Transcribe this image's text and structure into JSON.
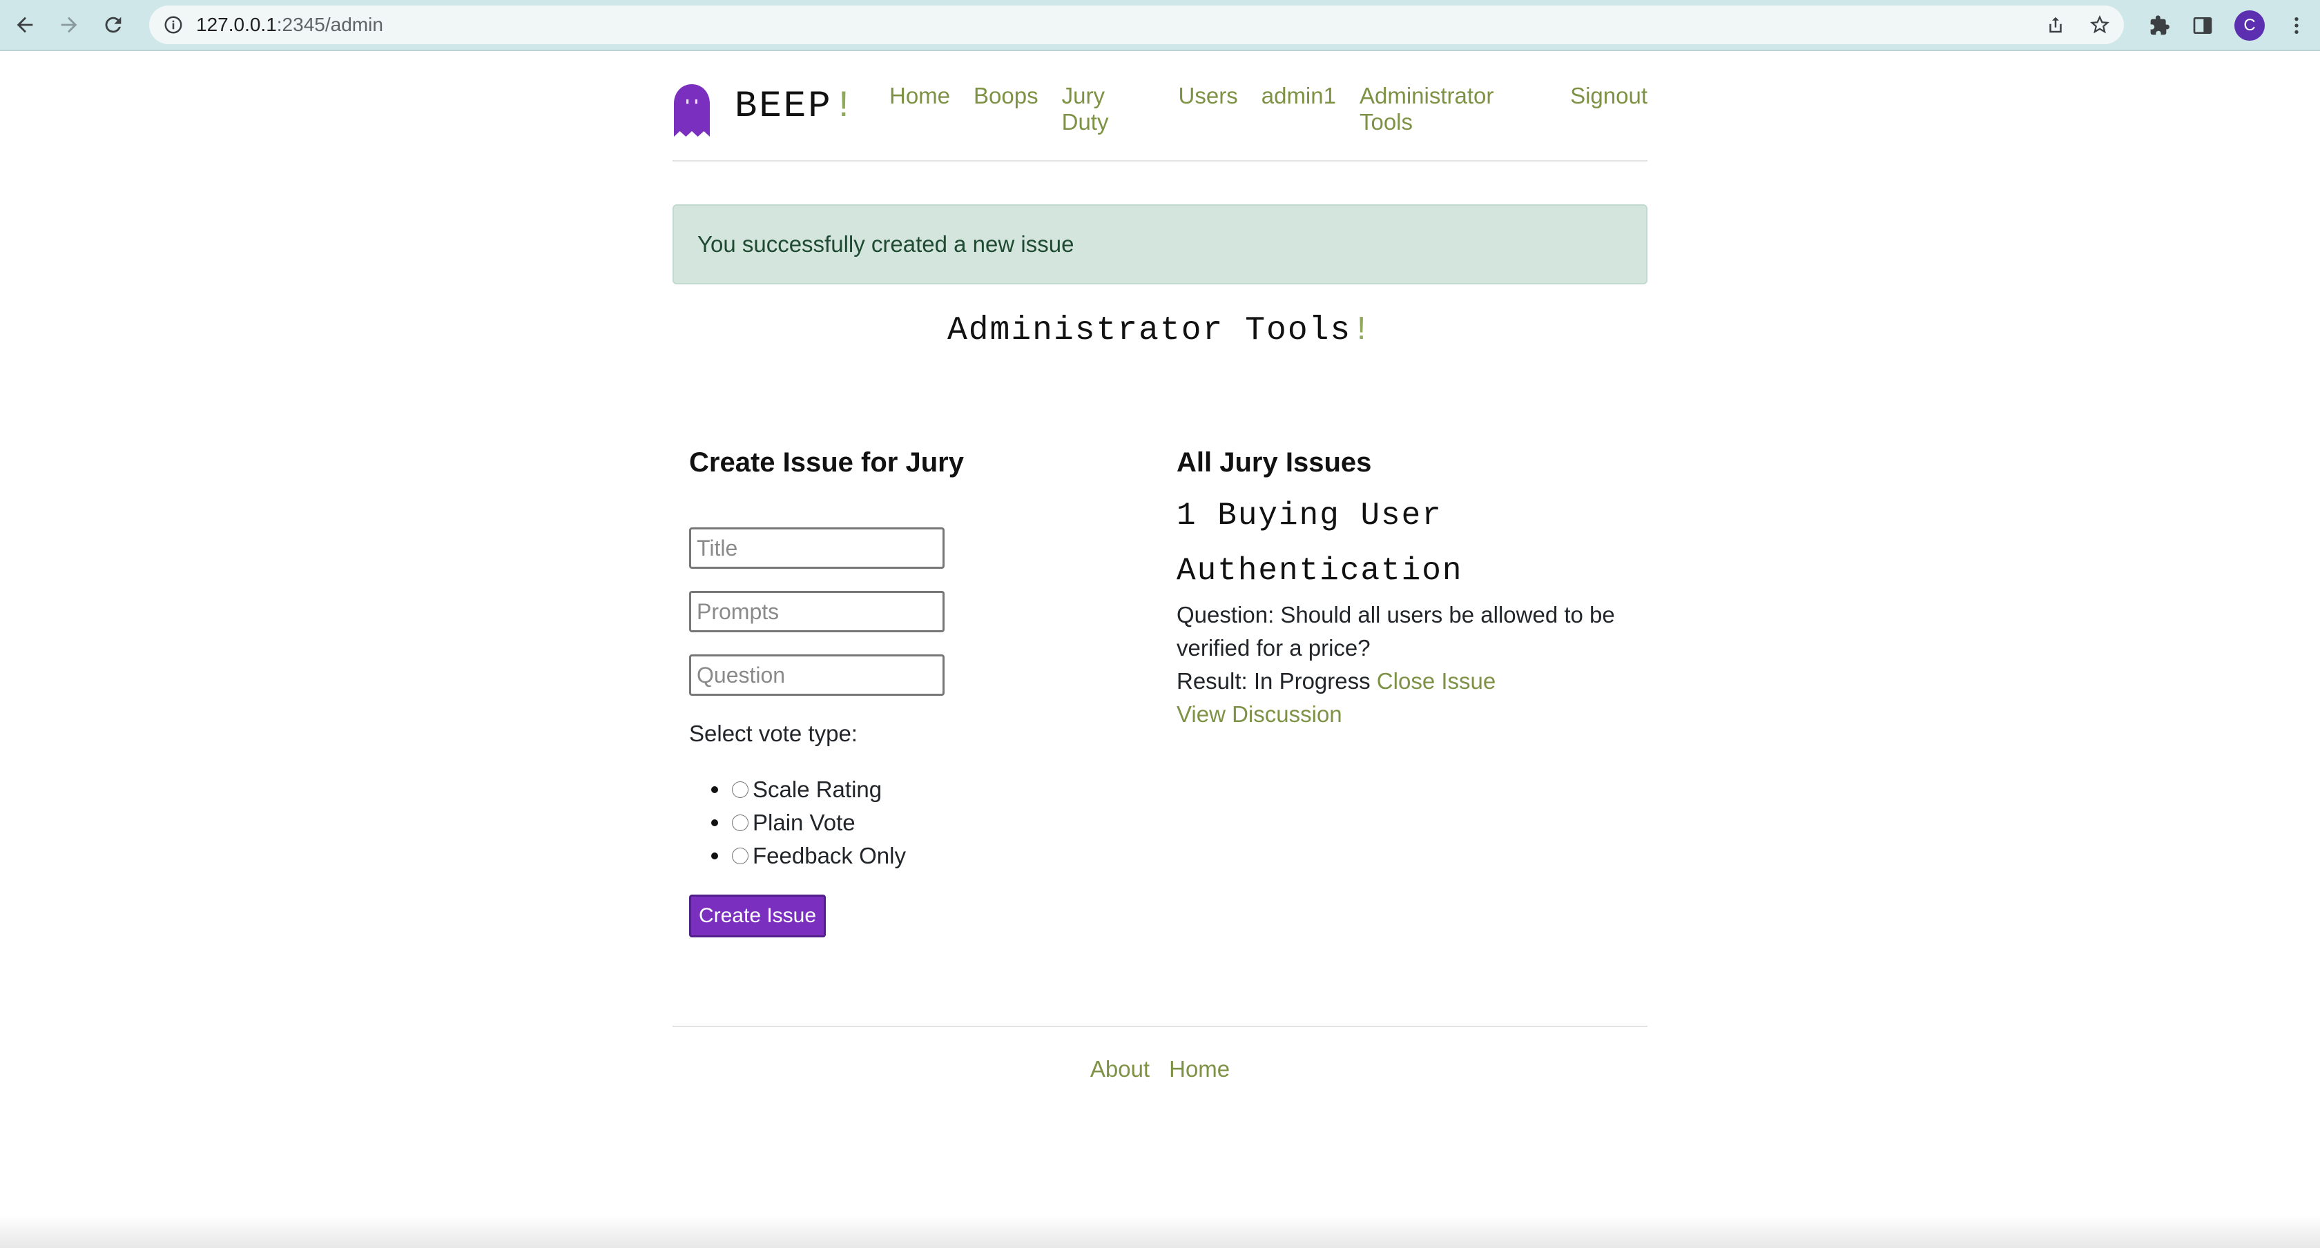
{
  "browser": {
    "url_host": "127.0.0.1",
    "url_rest": ":2345/admin",
    "profile_initial": "C"
  },
  "header": {
    "brand": "BEEP",
    "brand_mark": "!",
    "nav": [
      "Home",
      "Boops",
      "Jury Duty",
      "Users",
      "admin1",
      "Administrator Tools",
      "Signout"
    ]
  },
  "alert": {
    "message": "You successfully created a new issue"
  },
  "page": {
    "title": "Administrator Tools",
    "title_mark": "!"
  },
  "create_form": {
    "heading": "Create Issue for Jury",
    "title_placeholder": "Title",
    "prompts_placeholder": "Prompts",
    "question_placeholder": "Question",
    "vote_label": "Select vote type:",
    "vote_options": [
      "Scale Rating",
      "Plain Vote",
      "Feedback Only"
    ],
    "submit_label": "Create Issue"
  },
  "issues": {
    "heading": "All Jury Issues",
    "items": [
      {
        "title": "1 Buying User Authentication",
        "question": "Question: Should all users be allowed to be verified for a price?",
        "result": "Result: In Progress",
        "close_label": "Close Issue",
        "discussion_label": "View Discussion"
      }
    ]
  },
  "footer": {
    "links": [
      "About",
      "Home"
    ]
  },
  "colors": {
    "accent_link": "#7e9246",
    "button": "#7a2fbf",
    "alert_bg": "#d4e5dd",
    "chrome": "#cfe7e9"
  }
}
